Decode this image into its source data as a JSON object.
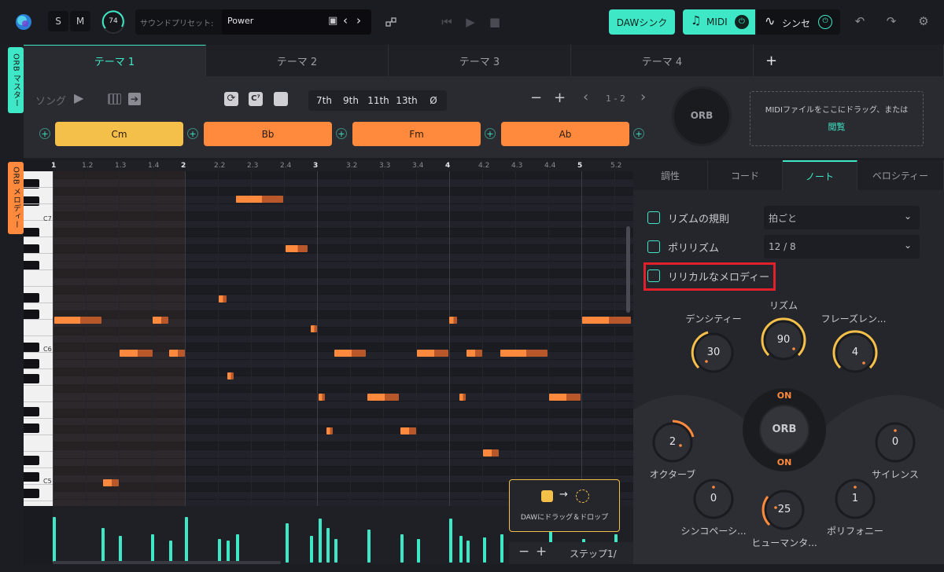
{
  "topbar": {
    "solo": "S",
    "mute": "M",
    "volume": "74",
    "preset_label": "サウンドプリセット:",
    "preset_value": "Power",
    "daw_sync": "DAWシンク",
    "midi": "MIDI",
    "synth": "シンセ"
  },
  "side_tabs": {
    "master": "ORB マスター",
    "melody": "ORB メロディー"
  },
  "themes": [
    "テーマ 1",
    "テーマ 2",
    "テーマ 3",
    "テーマ 4"
  ],
  "add_theme": "+",
  "song_label": "ソング",
  "extensions": [
    "7th",
    "9th",
    "11th",
    "13th",
    "Ø"
  ],
  "page_range": "1 - 2",
  "orb_logo": "ORB",
  "midi_drop": {
    "text": "MIDIファイルをここにドラッグ、または",
    "link": "閲覧"
  },
  "chords": [
    {
      "label": "Cm",
      "color": "#f5c04a"
    },
    {
      "label": "Bb",
      "color": "#ff8a3d"
    },
    {
      "label": "Fm",
      "color": "#ff8a3d"
    },
    {
      "label": "Ab",
      "color": "#ff8a3d"
    }
  ],
  "ruler": [
    "1",
    "1.2",
    "1.3",
    "1.4",
    "2",
    "2.2",
    "2.3",
    "2.4",
    "3",
    "3.2",
    "3.3",
    "3.4",
    "4",
    "4.2",
    "4.3",
    "4.4",
    "5",
    "5.2"
  ],
  "octave_labels": [
    "C7",
    "C6",
    "C5"
  ],
  "drag_drop": {
    "text": "DAWにドラッグ＆ドロップ"
  },
  "step_label": "ステップ1/",
  "right_tabs": [
    "調性",
    "コード",
    "ノート",
    "ベロシティー"
  ],
  "options": [
    {
      "label": "リズムの規則",
      "value": "拍ごと"
    },
    {
      "label": "ポリリズム",
      "value": "12 / 8"
    },
    {
      "label": "リリカルなメロディー",
      "value": ""
    }
  ],
  "knobs": {
    "density": {
      "label": "デンシティー",
      "value": "30"
    },
    "rhythm": {
      "label": "リズム",
      "value": "90"
    },
    "phrase": {
      "label": "フレーズレン...",
      "value": "4"
    },
    "octave": {
      "label": "オクターブ",
      "value": "2"
    },
    "silence": {
      "label": "サイレンス",
      "value": "0"
    },
    "syncopation": {
      "label": "シンコペーシ...",
      "value": "0"
    },
    "humanize": {
      "label": "ヒューマンタ...",
      "value": "25"
    },
    "polyphony": {
      "label": "ポリフォニー",
      "value": "1"
    }
  },
  "orb_center": {
    "top": "ON",
    "label": "ORB",
    "bottom": "ON"
  },
  "colors": {
    "teal": "#3ee8c6",
    "orange": "#ff8a3d",
    "yellow": "#f5c04a",
    "red_highlight": "#e0202a"
  }
}
